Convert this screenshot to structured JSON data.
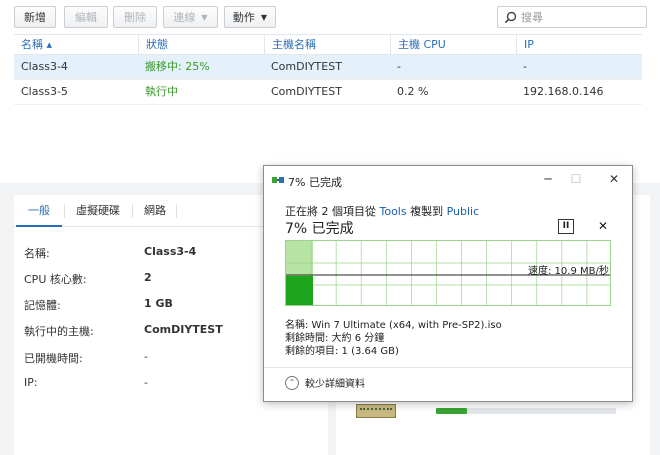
{
  "toolbar": {
    "create_label": "新增",
    "edit_label": "編輯",
    "delete_label": "刪除",
    "connect_label": "連線",
    "action_label": "動作",
    "search_placeholder": "搜尋"
  },
  "table": {
    "columns": [
      "名稱 ▴",
      "狀態",
      "主機名稱",
      "主機 CPU",
      "IP"
    ],
    "rows": [
      {
        "name": "Class3-4",
        "status": "搬移中: 25%",
        "host": "ComDIYTEST",
        "cpu": "-",
        "ip": "-",
        "selected": true
      },
      {
        "name": "Class3-5",
        "status": "執行中",
        "host": "ComDIYTEST",
        "cpu": "0.2 %",
        "ip": "192.168.0.146",
        "selected": false
      }
    ]
  },
  "details": {
    "tabs": [
      "一般",
      "虛擬硬碟",
      "網路"
    ],
    "active_tab": "一般",
    "fields": [
      {
        "label": "名稱:",
        "value": "Class3-4"
      },
      {
        "label": "CPU 核心數:",
        "value": "2"
      },
      {
        "label": "記憶體:",
        "value": "1 GB"
      },
      {
        "label": "執行中的主機:",
        "value": "ComDIYTEST"
      },
      {
        "label": "已開機時間:",
        "value": "-"
      },
      {
        "label": "IP:",
        "value": "-"
      }
    ],
    "ram_usage_fraction": 0.17
  },
  "dialog": {
    "title": "7% 已完成",
    "line1_prefix": "正在將 2 個項目從 ",
    "source": "Tools",
    "line1_mid": " 複製到 ",
    "destination": "Public",
    "big_progress": "7% 已完成",
    "progress_percent": 7,
    "speed": "速度: 10.9 MB/秒",
    "name_line": "名稱: Win 7 Ultimate (x64, with Pre-SP2).iso",
    "time_left": "剩餘時間: 大約 6 分鐘",
    "items_left": "剩餘的項目: 1 (3.64 GB)",
    "less_details": "較少詳細資料",
    "colors": {
      "progress_fill": "#1ea51e",
      "graph_line": "#9bd28c"
    }
  }
}
